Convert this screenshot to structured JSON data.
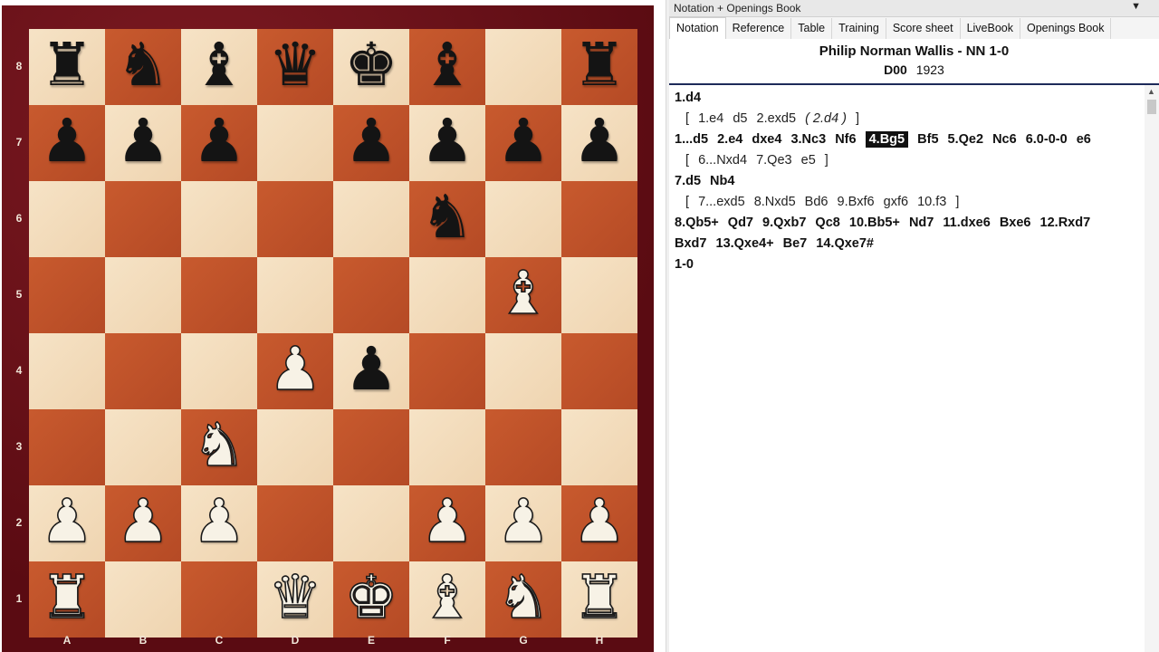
{
  "board": {
    "files": [
      "A",
      "B",
      "C",
      "D",
      "E",
      "F",
      "G",
      "H"
    ],
    "ranks": [
      "8",
      "7",
      "6",
      "5",
      "4",
      "3",
      "2",
      "1"
    ],
    "position": [
      [
        "br",
        "bn",
        "bb",
        "bq",
        "bk",
        "bb",
        "",
        "br"
      ],
      [
        "bp",
        "bp",
        "bp",
        "",
        "bp",
        "bp",
        "bp",
        "bp"
      ],
      [
        "",
        "",
        "",
        "",
        "",
        "bn",
        "",
        ""
      ],
      [
        "",
        "",
        "",
        "",
        "",
        "",
        "wb",
        ""
      ],
      [
        "",
        "",
        "",
        "wp",
        "bp",
        "",
        "",
        ""
      ],
      [
        "",
        "",
        "wn",
        "",
        "",
        "",
        "",
        ""
      ],
      [
        "wp",
        "wp",
        "wp",
        "",
        "",
        "wp",
        "wp",
        "wp"
      ],
      [
        "wr",
        "",
        "",
        "wq",
        "wk",
        "wb",
        "wn",
        "wr"
      ]
    ],
    "colors": {
      "light": "#f3dcbc",
      "dark": "#c1532a",
      "frame": "#6b0f17"
    }
  },
  "panel": {
    "title": "Notation + Openings Book",
    "dropdown_icon": "▼",
    "tabs": [
      "Notation",
      "Reference",
      "Table",
      "Training",
      "Score sheet",
      "LiveBook",
      "Openings Book"
    ],
    "active_tab": "Notation"
  },
  "game": {
    "players": "Philip Norman Wallis - NN  1-0",
    "eco": "D00",
    "year": "1923"
  },
  "notation": {
    "l1": [
      "1.d4"
    ],
    "l2": [
      "[",
      "1.e4",
      "d5",
      "2.exd5",
      "( 2.d4 )",
      "]"
    ],
    "l3": [
      "1...d5",
      "2.e4",
      "dxe4",
      "3.Nc3",
      "Nf6",
      "4.Bg5",
      "Bf5",
      "5.Qe2",
      "Nc6",
      "6.0-0-0",
      "e6"
    ],
    "l4": [
      "[",
      "6...Nxd4",
      "7.Qe3",
      "e5",
      "]"
    ],
    "l5": [
      "7.d5",
      "Nb4"
    ],
    "l6": [
      "[",
      "7...exd5",
      "8.Nxd5",
      "Bd6",
      "9.Bxf6",
      "gxf6",
      "10.f3",
      "]"
    ],
    "l7": [
      "8.Qb5+",
      "Qd7",
      "9.Qxb7",
      "Qc8",
      "10.Bb5+",
      "Nd7",
      "11.dxe6",
      "Bxe6",
      "12.Rxd7"
    ],
    "l8": [
      "Bxd7",
      "13.Qxe4+",
      "Be7",
      "14.Qxe7#"
    ],
    "l9": [
      "1-0"
    ]
  }
}
